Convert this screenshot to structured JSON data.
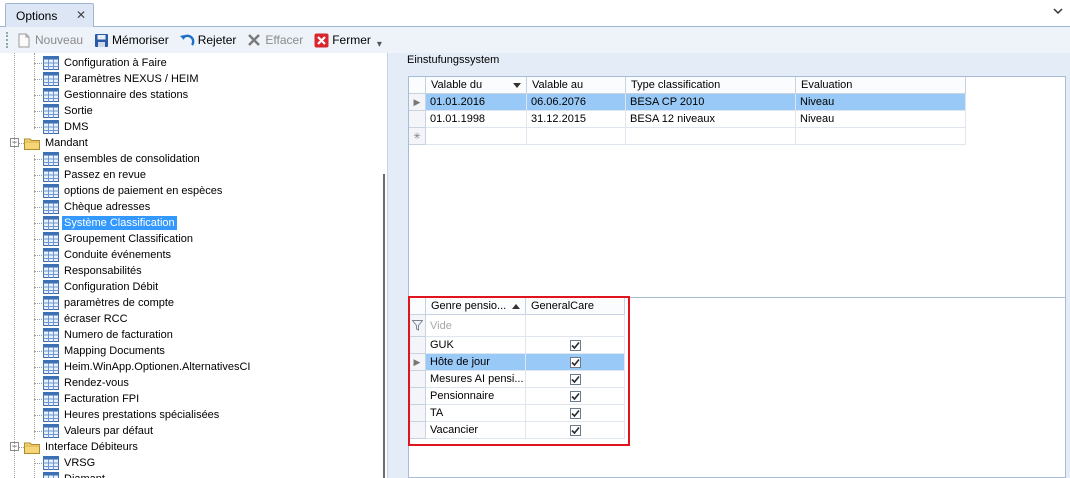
{
  "tab": {
    "title": "Options",
    "close": "✕"
  },
  "toolbar": {
    "nouveau": "Nouveau",
    "memoriser": "Mémoriser",
    "rejeter": "Rejeter",
    "effacer": "Effacer",
    "fermer": "Fermer"
  },
  "tree": {
    "items": [
      {
        "label": "Configuration à Faire",
        "type": "leaf"
      },
      {
        "label": "Paramètres NEXUS / HEIM",
        "type": "leaf"
      },
      {
        "label": "Gestionnaire des stations",
        "type": "leaf"
      },
      {
        "label": "Sortie",
        "type": "leaf"
      },
      {
        "label": "DMS",
        "type": "leaf"
      },
      {
        "label": "Mandant",
        "type": "folder"
      },
      {
        "label": "ensembles de consolidation",
        "type": "leaf"
      },
      {
        "label": "Passez en revue",
        "type": "leaf"
      },
      {
        "label": "options de paiement en espèces",
        "type": "leaf"
      },
      {
        "label": "Chèque adresses",
        "type": "leaf"
      },
      {
        "label": "Système Classification",
        "type": "leaf",
        "selected": true
      },
      {
        "label": "Groupement Classification",
        "type": "leaf"
      },
      {
        "label": "Conduite événements",
        "type": "leaf"
      },
      {
        "label": "Responsabilités",
        "type": "leaf"
      },
      {
        "label": "Configuration Débit",
        "type": "leaf"
      },
      {
        "label": "paramètres de compte",
        "type": "leaf"
      },
      {
        "label": "écraser RCC",
        "type": "leaf"
      },
      {
        "label": "Numero de facturation",
        "type": "leaf"
      },
      {
        "label": "Mapping Documents",
        "type": "leaf"
      },
      {
        "label": "Heim.WinApp.Optionen.AlternativesCI",
        "type": "leaf"
      },
      {
        "label": "Rendez-vous",
        "type": "leaf"
      },
      {
        "label": "Facturation FPI",
        "type": "leaf"
      },
      {
        "label": "Heures prestations spécialisées",
        "type": "leaf"
      },
      {
        "label": "Valeurs par défaut",
        "type": "leaf"
      },
      {
        "label": "Interface Débiteurs",
        "type": "folder"
      },
      {
        "label": "VRSG",
        "type": "leaf"
      },
      {
        "label": "Diamant",
        "type": "leaf"
      }
    ]
  },
  "right": {
    "section_label": "Einstufungssystem",
    "grid1": {
      "columns": [
        "Valable du",
        "Valable au",
        "Type classification",
        "Evaluation"
      ],
      "rows": [
        [
          "01.01.2016",
          "06.06.2076",
          "BESA CP 2010",
          "Niveau"
        ],
        [
          "01.01.1998",
          "31.12.2015",
          "BESA 12 niveaux",
          "Niveau"
        ]
      ]
    },
    "grid2": {
      "columns": [
        "Genre pensio...",
        "GeneralCare"
      ],
      "filter_placeholder": "Vide",
      "rows": [
        {
          "name": "GUK",
          "checked": true
        },
        {
          "name": "Hôte de jour",
          "checked": true
        },
        {
          "name": "Mesures AI pensi...",
          "checked": true
        },
        {
          "name": "Pensionnaire",
          "checked": true
        },
        {
          "name": "TA",
          "checked": true
        },
        {
          "name": "Vacancier",
          "checked": true
        }
      ]
    }
  },
  "colors": {
    "selection": "#3399ff",
    "grid_selection": "#99c9f7",
    "highlight_box": "#e0141e"
  }
}
